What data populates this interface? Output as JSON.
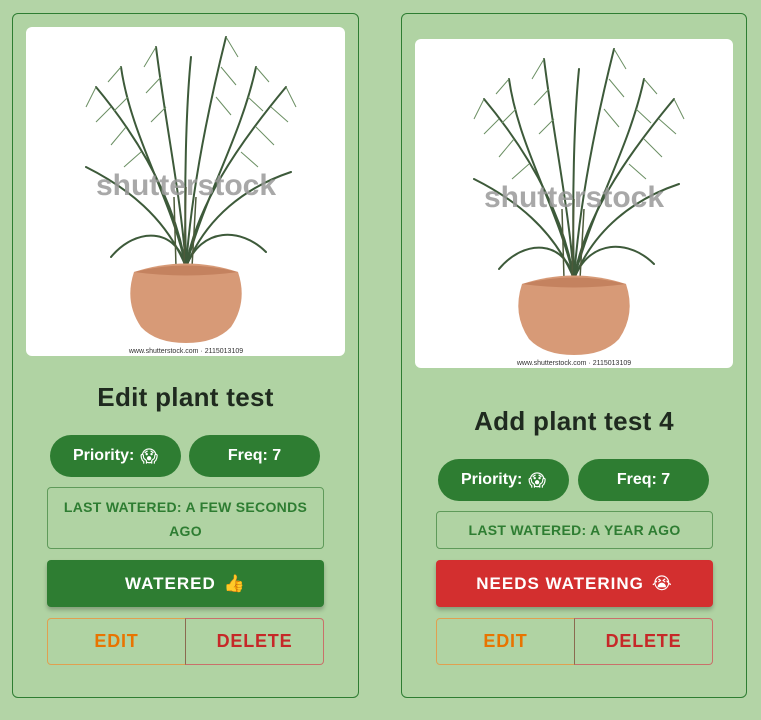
{
  "plants": [
    {
      "name": "Edit plant test",
      "image_watermark": "shutterstock",
      "image_caption": "www.shutterstock.com · 2115013109",
      "priority_label": "Priority:",
      "priority_emoji": "😱",
      "freq_label": "Freq: 7",
      "last_watered": "LAST WATERED: A FEW SECONDS AGO",
      "water_button_label": "WATERED",
      "water_button_emoji": "👍",
      "status_color": "#2e7d32",
      "edit_label": "EDIT",
      "delete_label": "DELETE"
    },
    {
      "name": "Add plant test 4",
      "image_watermark": "shutterstock",
      "image_caption": "www.shutterstock.com · 2115013109",
      "priority_label": "Priority:",
      "priority_emoji": "😱",
      "freq_label": "Freq: 7",
      "last_watered": "LAST WATERED: A YEAR AGO",
      "water_button_label": "NEEDS WATERING",
      "water_button_emoji": "😭",
      "status_color": "#d32f2f",
      "edit_label": "EDIT",
      "delete_label": "DELETE"
    }
  ],
  "colors": {
    "background": "#b3d4a6",
    "primary_green": "#2e7d32",
    "alert_red": "#d32f2f",
    "edit_orange": "#e87400",
    "delete_red": "#c62828"
  }
}
